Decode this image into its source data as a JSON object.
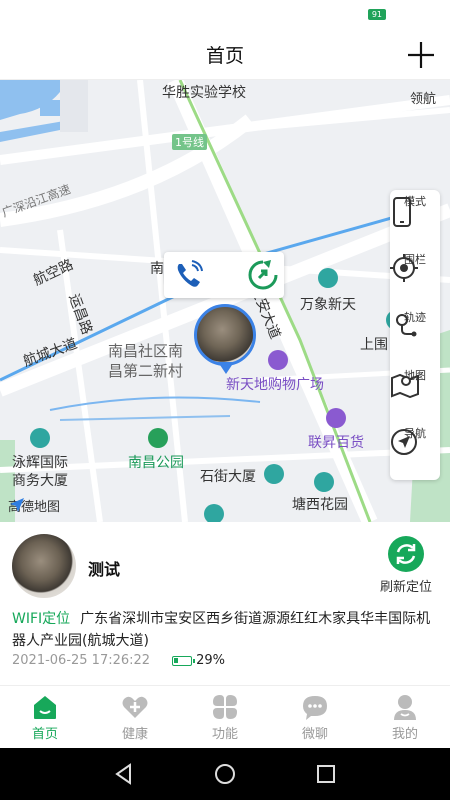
{
  "status_bar": {
    "battery": "91"
  },
  "header": {
    "title": "首页"
  },
  "map": {
    "labels": {
      "school": "华胜实验学校",
      "metro_line": "1号线",
      "expressway": "广深沿江高速",
      "hangkong_road": "航空路",
      "yunchang_road": "运昌路",
      "nanhang": "南航明",
      "baoan_avenue": "宝安大道",
      "wanxiang": "万象新天",
      "hangcheng_avenue": "航城大道",
      "nanchang_community": "南昌社区南",
      "nanchang_village": "昌第二新村",
      "shangwei": "上围",
      "xintiandi": "新天地购物广场",
      "lianhua": "联昇百货",
      "yonghui": "泳辉国际",
      "yonghui2": "商务大厦",
      "nanchang_park": "南昌公园",
      "shijie": "石街大厦",
      "tangxi": "塘西花园",
      "linghang": "领航",
      "amap": "高德地图"
    },
    "toolbar": [
      {
        "label": "模式",
        "icon": "phone-mode-icon"
      },
      {
        "label": "围栏",
        "icon": "fence-target-icon"
      },
      {
        "label": "轨迹",
        "icon": "track-icon"
      },
      {
        "label": "地图",
        "icon": "map-icon"
      },
      {
        "label": "导航",
        "icon": "navigation-icon"
      }
    ]
  },
  "device": {
    "name": "测试",
    "refresh_label": "刷新定位",
    "location_type": "WIFI定位",
    "address": "广东省深圳市宝安区西乡街道源源红红木家具华丰国际机器人产业园(航城大道)",
    "timestamp": "2021-06-25 17:26:22",
    "battery": "29%",
    "battery_level": 0.29
  },
  "tabs": [
    {
      "label": "首页",
      "icon": "home-icon",
      "active": true
    },
    {
      "label": "健康",
      "icon": "heart-plus-icon",
      "active": false
    },
    {
      "label": "功能",
      "icon": "grid-clover-icon",
      "active": false
    },
    {
      "label": "微聊",
      "icon": "chat-bubble-icon",
      "active": false
    },
    {
      "label": "我的",
      "icon": "profile-icon",
      "active": false
    }
  ],
  "colors": {
    "accent": "#17a85a",
    "marker": "#3b82e6",
    "poi_purple": "#7a4fc4"
  }
}
